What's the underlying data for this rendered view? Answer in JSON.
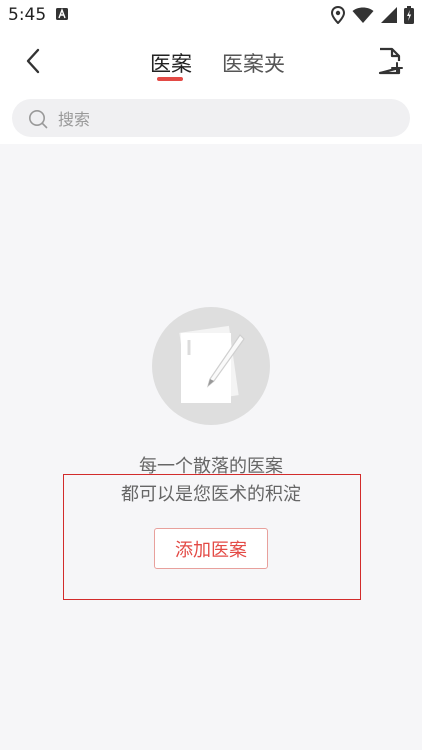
{
  "status_bar": {
    "time": "5:45",
    "icons": [
      "a-notification-icon",
      "location-icon",
      "wifi-icon",
      "signal-icon",
      "battery-icon"
    ]
  },
  "header": {
    "tabs": [
      {
        "label": "医案",
        "active": true
      },
      {
        "label": "医案夹",
        "active": false
      }
    ],
    "icons": [
      "back-icon",
      "new-document-icon"
    ]
  },
  "search": {
    "placeholder": "搜索",
    "value": ""
  },
  "empty_state": {
    "line1": "每一个散落的医案",
    "line2": "都可以是您医术的积淀",
    "button_label": "添加医案",
    "illustration": "note-pencil-icon"
  },
  "colors": {
    "accent": "#e34a45",
    "background": "#f6f6f8",
    "highlight": "#d22b2b"
  }
}
